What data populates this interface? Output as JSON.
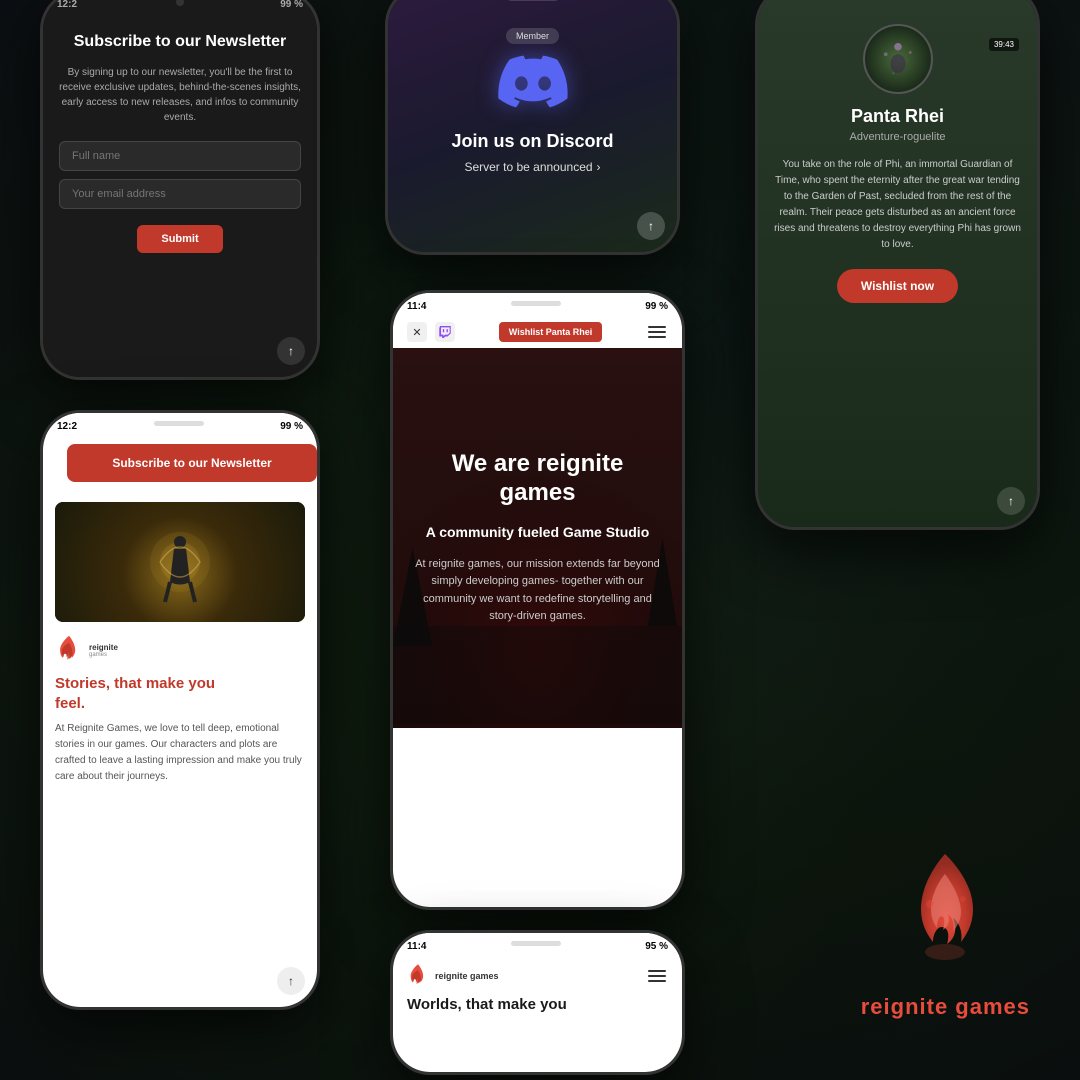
{
  "background": {
    "color1": "#1a1a2e",
    "color2": "#0d1a0d"
  },
  "phone_newsletter_top": {
    "title": "Subscribe to our Newsletter",
    "description": "By signing up to our newsletter, you'll be the first to receive exclusive updates, behind-the-scenes insights, early access to new releases, and infos to community events.",
    "full_name_placeholder": "Full name",
    "email_placeholder": "Your email address",
    "submit_label": "Submit",
    "status_time": "12:2",
    "status_battery": "99 %"
  },
  "phone_discord": {
    "member_badge": "Member",
    "title": "Join us on Discord",
    "server_text": "Server to be announced",
    "arrow": "›"
  },
  "phone_panta": {
    "status_time": "39:43",
    "game_title": "Panta Rhei",
    "game_genre": "Adventure-roguelite",
    "description": "You take on the role of Phi, an immortal Guardian of Time, who spent the eternity after the great war tending to the Garden of Past, secluded from the rest of the realm. Their peace gets disturbed as an ancient force rises and threatens to destroy everything Phi has grown to love.",
    "wishlist_label": "Wishlist now"
  },
  "phone_stories": {
    "status_time": "12:2",
    "status_battery": "99 %",
    "subscribe_btn": "Subscribe to our Newsletter",
    "headline_part1": "Stories, that make you",
    "headline_part2": "feel.",
    "body": "At Reignite Games, we love to tell deep, emotional stories in our games. Our characters and plots are crafted to leave a lasting impression and make you truly care about their journeys."
  },
  "phone_main": {
    "status_time": "11:4",
    "status_battery": "99 %",
    "wishlist_btn": "Wishlist Panta Rhei",
    "hero_title": "We are reignite games",
    "hero_subtitle": "A community fueled Game Studio",
    "hero_body": "At reignite games, our mission extends far beyond simply developing games- together with our community we want to redefine storytelling and story-driven games."
  },
  "phone_worlds": {
    "status_time": "11:4",
    "status_battery": "95 %",
    "title": "Worlds, that make you"
  },
  "brand": {
    "name_prefix": "re",
    "name_suffix": "ignite games"
  },
  "icons": {
    "flame": "🔥",
    "discord": "🎮",
    "twitter_x": "✕",
    "twitch": "📺",
    "arrow_up": "↑",
    "chevron_right": "›",
    "menu": "≡"
  }
}
